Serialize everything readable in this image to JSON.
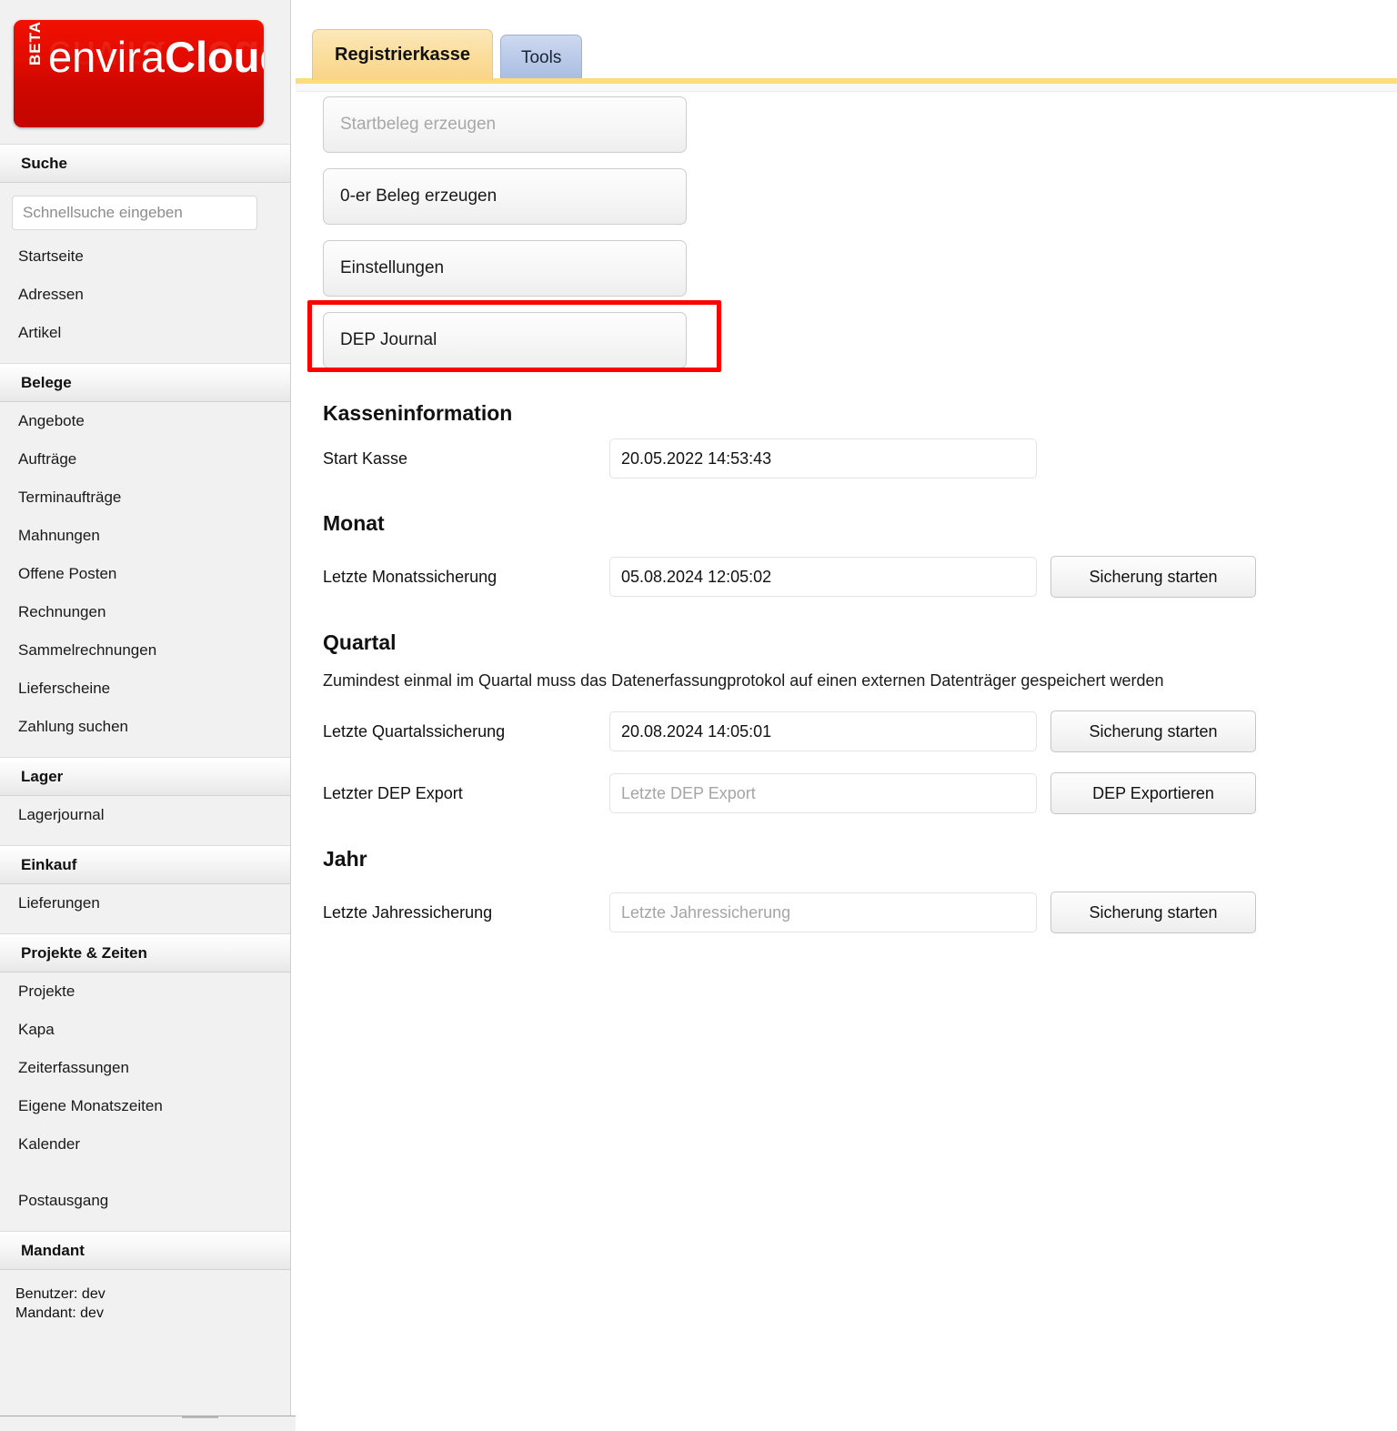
{
  "brand": {
    "beta_label": "BETA",
    "name_light": "envira",
    "name_bold": "Cloud"
  },
  "sidebar": {
    "sections": [
      {
        "id": "suche",
        "title": "Suche",
        "search_placeholder": "Schnellsuche eingeben",
        "items": [
          {
            "label": "Startseite"
          },
          {
            "label": "Adressen"
          },
          {
            "label": "Artikel"
          }
        ]
      },
      {
        "id": "belege",
        "title": "Belege",
        "items": [
          {
            "label": "Angebote"
          },
          {
            "label": "Aufträge"
          },
          {
            "label": "Terminaufträge"
          },
          {
            "label": "Mahnungen"
          },
          {
            "label": "Offene Posten"
          },
          {
            "label": "Rechnungen"
          },
          {
            "label": "Sammelrechnungen"
          },
          {
            "label": "Lieferscheine"
          },
          {
            "label": "Zahlung suchen"
          }
        ]
      },
      {
        "id": "lager",
        "title": "Lager",
        "items": [
          {
            "label": "Lagerjournal"
          }
        ]
      },
      {
        "id": "einkauf",
        "title": "Einkauf",
        "items": [
          {
            "label": "Lieferungen"
          }
        ]
      },
      {
        "id": "projekte-zeiten",
        "title": "Projekte & Zeiten",
        "items": [
          {
            "label": "Projekte"
          },
          {
            "label": "Kapa"
          },
          {
            "label": "Zeiterfassungen"
          },
          {
            "label": "Eigene Monatszeiten"
          },
          {
            "label": "Kalender"
          },
          {
            "label": "Postausgang",
            "gap": true
          }
        ]
      },
      {
        "id": "mandant",
        "title": "Mandant",
        "info_lines": [
          "Benutzer: dev",
          "Mandant: dev"
        ]
      }
    ]
  },
  "tabs": [
    {
      "label": "Registrierkasse",
      "active": true
    },
    {
      "label": "Tools",
      "active": false
    }
  ],
  "actions": [
    {
      "label": "Startbeleg erzeugen",
      "disabled": true,
      "highlighted": false
    },
    {
      "label": "0-er Beleg erzeugen",
      "disabled": false,
      "highlighted": false
    },
    {
      "label": "Einstellungen",
      "disabled": false,
      "highlighted": false
    },
    {
      "label": "DEP Journal",
      "disabled": false,
      "highlighted": true
    }
  ],
  "kasseninformation": {
    "heading": "Kasseninformation",
    "start_kasse_label": "Start Kasse",
    "start_kasse_value": "20.05.2022 14:53:43"
  },
  "monat": {
    "heading": "Monat",
    "label": "Letzte Monatssicherung",
    "value": "05.08.2024 12:05:02",
    "button": "Sicherung starten"
  },
  "quartal": {
    "heading": "Quartal",
    "note": "Zumindest einmal im Quartal muss das Datenerfassungprotokol auf einen externen Datenträger gespeichert werden",
    "backup_label": "Letzte Quartalssicherung",
    "backup_value": "20.08.2024 14:05:01",
    "backup_button": "Sicherung starten",
    "dep_label": "Letzter DEP Export",
    "dep_placeholder": "Letzte DEP Export",
    "dep_value": "",
    "dep_button": "DEP Exportieren"
  },
  "jahr": {
    "heading": "Jahr",
    "label": "Letzte Jahressicherung",
    "placeholder": "Letzte Jahressicherung",
    "value": "",
    "button": "Sicherung starten"
  },
  "colors": {
    "brand_red": "#e00b00",
    "accent_yellow": "#fcdd79",
    "active_tab": "#fbdd9a",
    "inactive_tab": "#b8c9e8",
    "highlight_red": "#ff0000"
  }
}
